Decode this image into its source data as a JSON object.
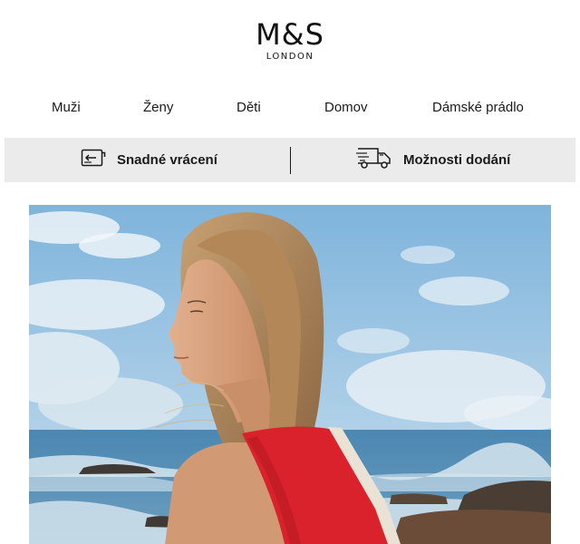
{
  "brand": {
    "name": "M&S",
    "tagline": "LONDON"
  },
  "nav": {
    "items": [
      {
        "label": "Muži"
      },
      {
        "label": "Ženy"
      },
      {
        "label": "Děti"
      },
      {
        "label": "Domov"
      },
      {
        "label": "Dámské prádlo"
      }
    ]
  },
  "service_strip": {
    "returns": {
      "label": "Snadné vrácení",
      "icon": "returns-icon"
    },
    "delivery": {
      "label": "Možnosti dodání",
      "icon": "delivery-truck-icon"
    }
  },
  "hero": {
    "alt": "woman-in-red-top-by-the-sea",
    "colors": {
      "sky": "#a9cde6",
      "sea": "#3d7aa3",
      "top": "#d9222c",
      "hair": "#b58a5c",
      "skin": "#d8a07c"
    }
  },
  "colors": {
    "strip_bg": "#ebebeb",
    "text": "#1a1a1a"
  }
}
